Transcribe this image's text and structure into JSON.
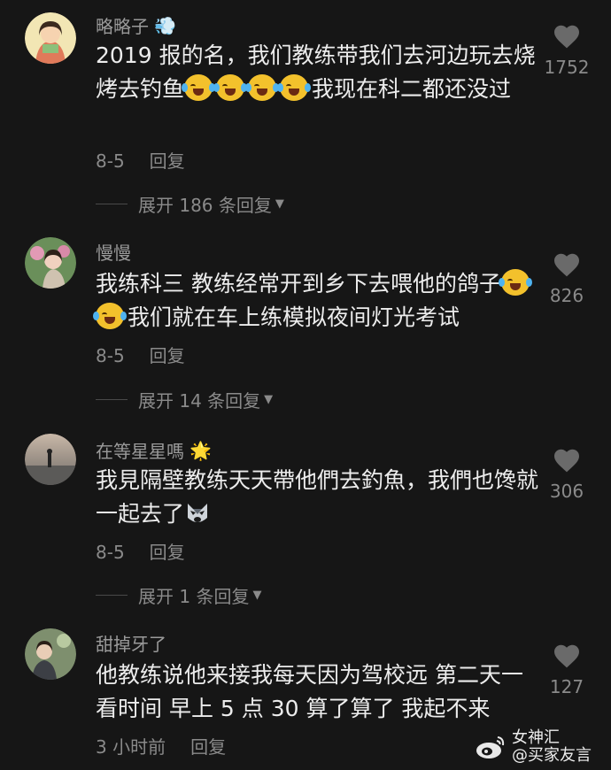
{
  "comments": [
    {
      "username": "略略子",
      "username_emoji": "💨",
      "text_before": "2019 报的名，我们教练带我们去河边玩去烧烤去钓鱼",
      "text_after": "我现在科二都还没过",
      "date": "8-5",
      "reply_label": "回复",
      "likes": "1752",
      "expand_label": "展开 186 条回复"
    },
    {
      "username": "慢慢",
      "text_before": "我练科三 教练经常开到乡下去喂他的鸽子",
      "text_after": "我们就在车上练模拟夜间灯光考试",
      "date": "8-5",
      "reply_label": "回复",
      "likes": "826",
      "expand_label": "展开 14 条回复"
    },
    {
      "username": "在等星星嗎",
      "username_emoji": "🌟",
      "text_before": "我見隔壁教练天天帶他們去釣魚，我們也馋就一起去了",
      "date": "8-5",
      "reply_label": "回复",
      "likes": "306",
      "expand_label": "展开 1 条回复"
    },
    {
      "username": "甜掉牙了",
      "text_before": "他教练说他来接我每天因为驾校远 第二天一看时间 早上 5 点 30 算了算了 我起不来",
      "date": "3 小时前",
      "reply_label": "回复",
      "likes": "127"
    }
  ],
  "watermark": {
    "line1": "女神汇",
    "line2": "@买家友言"
  },
  "colors": {
    "background": "#161616",
    "text": "#ececec",
    "secondary": "#8a8a8a"
  },
  "icons": {
    "like": "heart-icon",
    "expand": "triangle-down-icon",
    "watermark": "weibo-logo-icon"
  }
}
